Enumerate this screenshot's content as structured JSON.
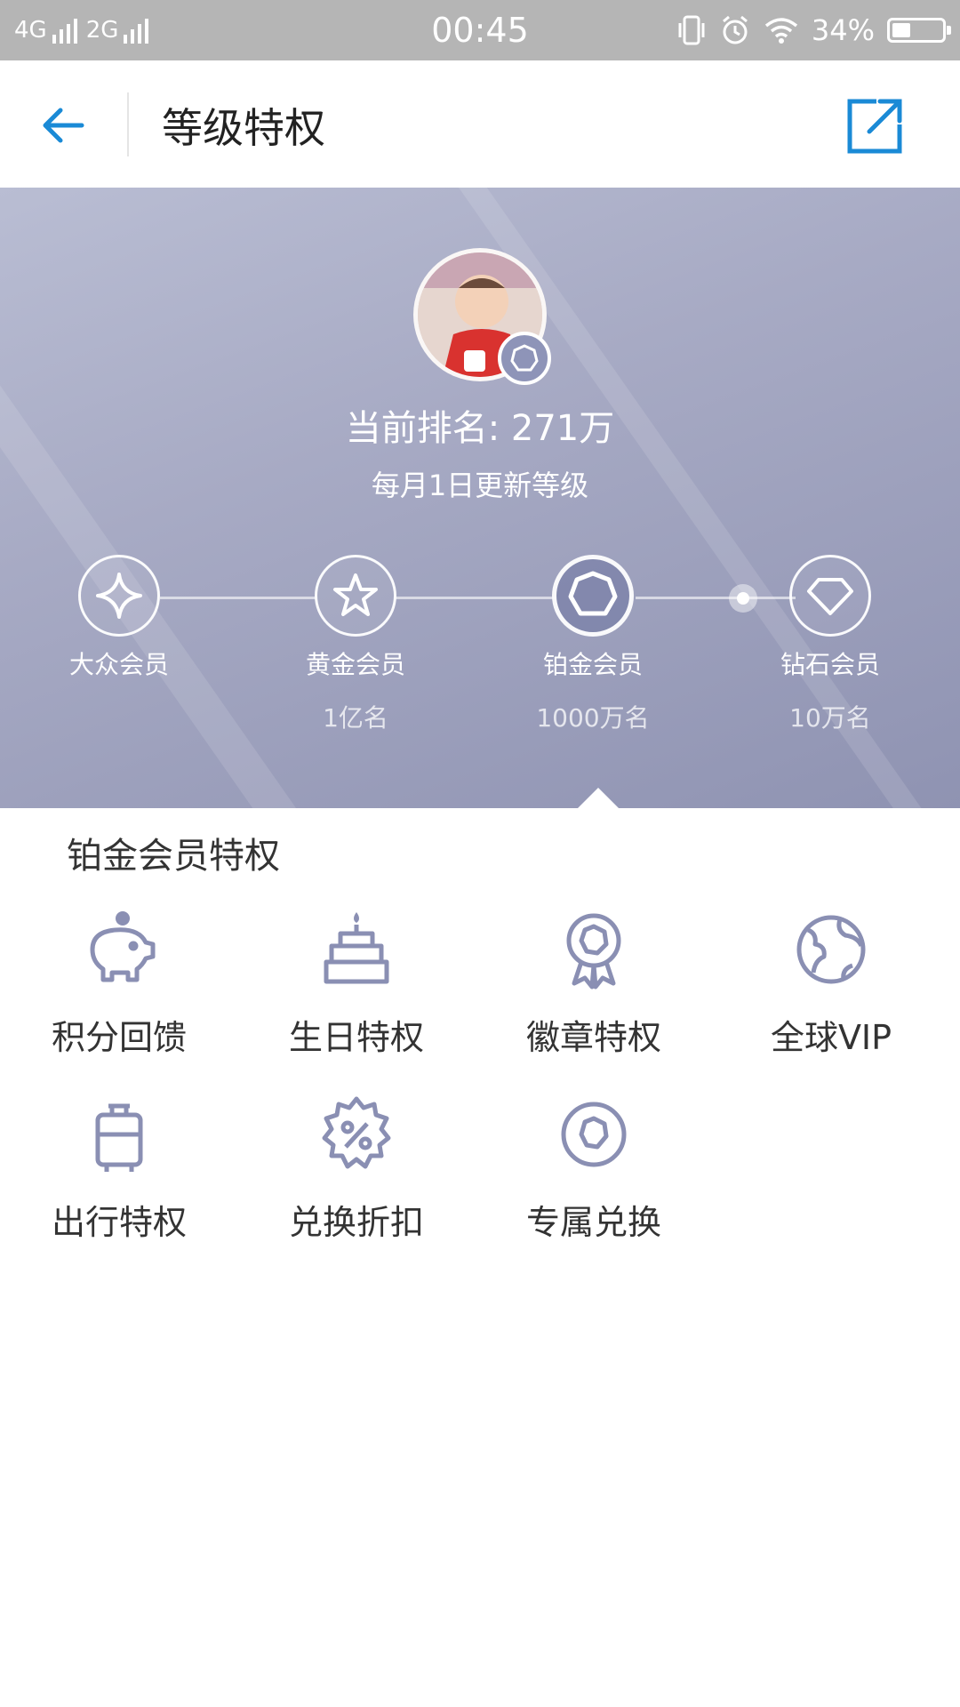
{
  "status_bar": {
    "net1": "4G",
    "net2": "2G",
    "time": "00:45",
    "battery": "34%"
  },
  "header": {
    "title": "等级特权",
    "back_icon": "arrow-left-icon",
    "share_icon": "share-external-icon",
    "accent": "#1a8ad6"
  },
  "hero": {
    "rank": "当前排名: 271万",
    "update_note": "每月1日更新等级"
  },
  "levels": [
    {
      "name": "大众会员",
      "count": "",
      "icon": "sparkle-icon"
    },
    {
      "name": "黄金会员",
      "count": "1亿名",
      "icon": "star-icon"
    },
    {
      "name": "铂金会员",
      "count": "1000万名",
      "icon": "heptagon-icon"
    },
    {
      "name": "钻石会员",
      "count": "10万名",
      "icon": "diamond-icon"
    }
  ],
  "privileges": {
    "title": "铂金会员特权",
    "items": [
      {
        "label": "积分回馈",
        "icon": "piggy-bank-icon"
      },
      {
        "label": "生日特权",
        "icon": "cake-icon"
      },
      {
        "label": "徽章特权",
        "icon": "badge-icon"
      },
      {
        "label": "全球VIP",
        "icon": "globe-icon"
      },
      {
        "label": "出行特权",
        "icon": "luggage-icon"
      },
      {
        "label": "兑换折扣",
        "icon": "percent-badge-icon"
      },
      {
        "label": "专属兑换",
        "icon": "exclusive-badge-icon"
      }
    ]
  },
  "colors": {
    "icon_stroke": "#8a8fb3",
    "hero_start": "#b9bdd3",
    "hero_end": "#8f93b2"
  }
}
